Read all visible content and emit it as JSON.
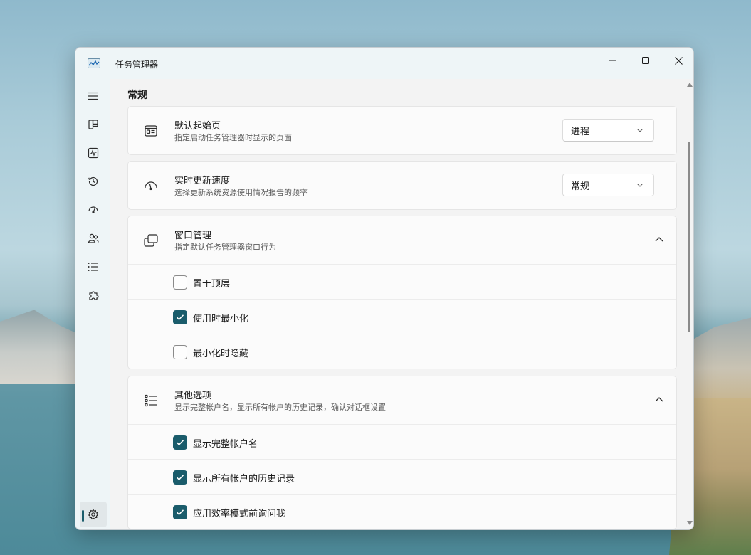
{
  "window": {
    "title": "任务管理器",
    "controls": {
      "minimize": "minimize-icon",
      "maximize": "maximize-icon",
      "close": "close-icon"
    }
  },
  "sidebar": {
    "items": [
      {
        "name": "menu",
        "icon": "hamburger-icon"
      },
      {
        "name": "processes",
        "icon": "processes-icon"
      },
      {
        "name": "performance",
        "icon": "performance-icon"
      },
      {
        "name": "app-history",
        "icon": "history-icon"
      },
      {
        "name": "startup-apps",
        "icon": "speedometer-icon"
      },
      {
        "name": "users",
        "icon": "users-icon"
      },
      {
        "name": "details",
        "icon": "list-icon"
      },
      {
        "name": "services",
        "icon": "puzzle-icon"
      },
      {
        "name": "settings",
        "icon": "gear-icon",
        "active": true
      }
    ]
  },
  "settings": {
    "section_title": "常规",
    "default_page": {
      "title": "默认起始页",
      "desc": "指定启动任务管理器时显示的页面",
      "value": "进程"
    },
    "refresh_speed": {
      "title": "实时更新速度",
      "desc": "选择更新系统资源使用情况报告的频率",
      "value": "常规"
    },
    "window_management": {
      "title": "窗口管理",
      "desc": "指定默认任务管理器窗口行为",
      "options": [
        {
          "label": "置于顶层",
          "checked": false
        },
        {
          "label": "使用时最小化",
          "checked": true
        },
        {
          "label": "最小化时隐藏",
          "checked": false
        }
      ]
    },
    "other_options": {
      "title": "其他选项",
      "desc": "显示完整帐户名，显示所有帐户的历史记录，确认对话框设置",
      "options": [
        {
          "label": "显示完整帐户名",
          "checked": true
        },
        {
          "label": "显示所有帐户的历史记录",
          "checked": true
        },
        {
          "label": "应用效率模式前询问我",
          "checked": true
        }
      ]
    }
  },
  "colors": {
    "accent": "#1a5c6b"
  }
}
